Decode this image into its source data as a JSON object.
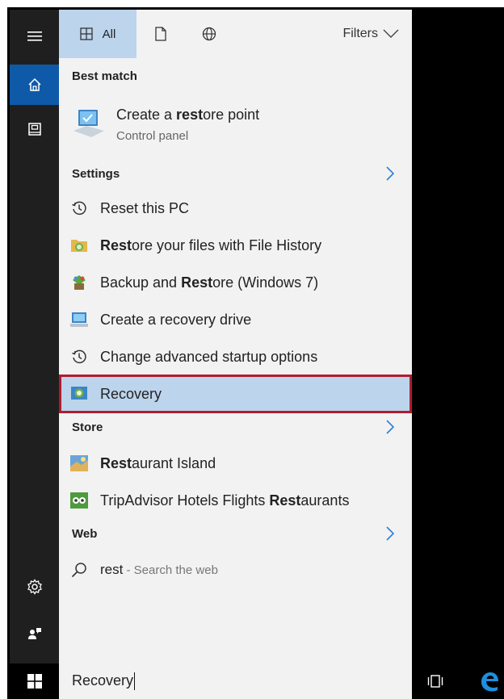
{
  "rail": {
    "items": [
      {
        "name": "menu",
        "icon": "hamburger-icon"
      },
      {
        "name": "home",
        "icon": "home-icon"
      },
      {
        "name": "notebook",
        "icon": "notebook-icon"
      },
      {
        "name": "settings",
        "icon": "gear-icon"
      },
      {
        "name": "feedback",
        "icon": "feedback-icon"
      }
    ]
  },
  "tabs": {
    "all_label": "All",
    "filters_label": "Filters"
  },
  "best_match": {
    "header": "Best match",
    "title_before": "Create a ",
    "title_bold": "rest",
    "title_after": "ore point",
    "subtitle": "Control panel"
  },
  "settings": {
    "header": "Settings",
    "items": [
      {
        "before": "",
        "bold": "",
        "after": "Reset this PC"
      },
      {
        "before": "",
        "bold": "Rest",
        "after": "ore your files with File History"
      },
      {
        "before": "Backup and ",
        "bold": "Rest",
        "after": "ore (Windows 7)"
      },
      {
        "before": "",
        "bold": "",
        "after": "Create a recovery drive"
      },
      {
        "before": "",
        "bold": "",
        "after": "Change advanced startup options"
      },
      {
        "before": "",
        "bold": "",
        "after": "Recovery"
      }
    ]
  },
  "store": {
    "header": "Store",
    "items": [
      {
        "before": "",
        "bold": "Rest",
        "after": "aurant Island"
      },
      {
        "before": "TripAdvisor Hotels Flights ",
        "bold": "Rest",
        "after": "aurants"
      }
    ]
  },
  "web": {
    "header": "Web",
    "query": "rest",
    "suffix": " - Search the web"
  },
  "search": {
    "value": "Recovery"
  },
  "colors": {
    "accent": "#0f5aa8",
    "selected_bg": "#bcd4ec",
    "highlight_border": "#b01c2e",
    "edge_blue": "#1e8fe0"
  }
}
